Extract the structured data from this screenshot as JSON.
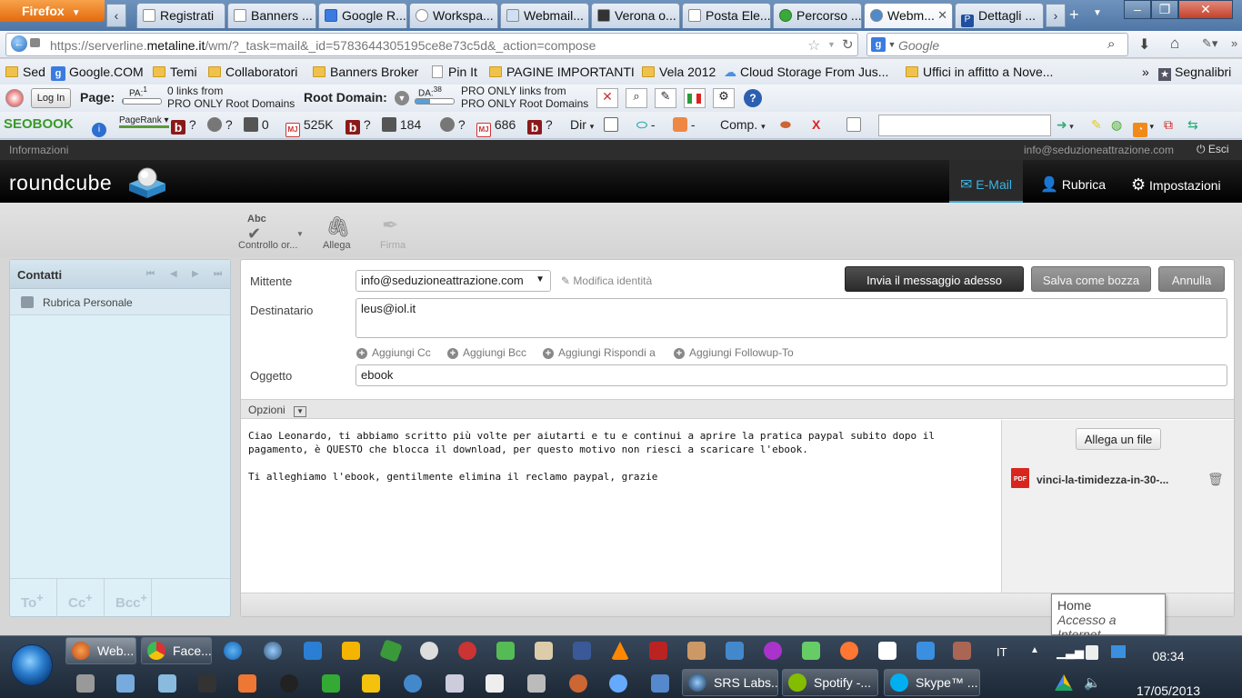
{
  "browser": {
    "firefox_label": "Firefox",
    "tabs": [
      "Registrati",
      "Banners ...",
      "Google R...",
      "Workspa...",
      "Webmail...",
      "Verona o...",
      "Posta Ele...",
      "Percorso ...",
      "Webm...",
      "Dettagli ..."
    ],
    "url_prefix": "https://serverline.",
    "url_domain": "metaline.it",
    "url_rest": "/wm/?_task=mail&_id=5783644305195ce8e73c5d&_action=compose",
    "search_placeholder": "Google",
    "bookmarks": [
      "Sed",
      "Google.COM",
      "Temi",
      "Collaboratori",
      "Banners Broker",
      "Pin It",
      "PAGINE IMPORTANTI",
      "Vela 2012",
      "Cloud Storage From Jus...",
      "Uffici in affitto a Nove...",
      "Segnalibri"
    ]
  },
  "mozbar": {
    "login": "Log In",
    "page_label": "Page:",
    "pa_label": "PA:",
    "pa_value": "1",
    "page_links_1": "0 links from",
    "page_links_2": "PRO ONLY Root Domains",
    "root_domain_label": "Root Domain:",
    "da_label": "DA:",
    "da_value": "38",
    "root_links_1": "PRO ONLY links from",
    "root_links_2": "PRO ONLY Root Domains"
  },
  "seobar": {
    "logo": "SEOBOOK",
    "pagerank": "PageRank",
    "v1": "?",
    "v2": "?",
    "v3": "0",
    "v4": "525K",
    "v5": "?",
    "v6": "184",
    "v7": "?",
    "v8": "686",
    "v9": "?",
    "dir": "Dir",
    "dash1": "-",
    "dash2": "-",
    "comp": "Comp."
  },
  "roundcube": {
    "info": "Informazioni",
    "user_email": "info@seduzioneattrazione.com",
    "logout": "Esci",
    "logo": "roundcube",
    "nav": [
      "E-Mail",
      "Rubrica",
      "Impostazioni"
    ],
    "toolbar": [
      "Controllo or...",
      "Allega",
      "Firma"
    ],
    "contacts_title": "Contatti",
    "address_book": "Rubrica Personale",
    "recipient_buttons": [
      "To",
      "Cc",
      "Bcc"
    ]
  },
  "compose": {
    "sender_label": "Mittente",
    "sender_value": "info@seduzioneattrazione.com",
    "edit_identity": "Modifica identità",
    "send_button": "Invia il messaggio adesso",
    "save_draft": "Salva come bozza",
    "cancel": "Annulla",
    "to_label": "Destinatario",
    "to_value": "leus@iol.it",
    "add_links": [
      "Aggiungi Cc",
      "Aggiungi Bcc",
      "Aggiungi Rispondi a",
      "Aggiungi Followup-To"
    ],
    "subject_label": "Oggetto",
    "subject_value": "ebook",
    "options_label": "Opzioni",
    "body": "Ciao Leonardo, ti abbiamo scritto più volte per aiutarti e tu e continui a aprire la pratica paypal subito dopo il\npagamento, è QUESTO che blocca il download, per questo motivo non riesci a scaricare l'ebook.\n\nTi alleghiamo l'ebook, gentilmente elimina il reclamo paypal, grazie",
    "attach_button": "Allega un file",
    "attachment_name": "vinci-la-timidezza-in-30-...",
    "attachment_type": "PDF"
  },
  "tooltip": {
    "title": "Home",
    "subtitle": "Accesso a Internet"
  },
  "taskbar": {
    "apps_top": [
      "Web...",
      "Face..."
    ],
    "apps_bottom": [
      "SRS Labs...",
      "Spotify -...",
      "Skype™ ..."
    ],
    "lang": "IT",
    "time": "08:34",
    "date": "17/05/2013"
  }
}
